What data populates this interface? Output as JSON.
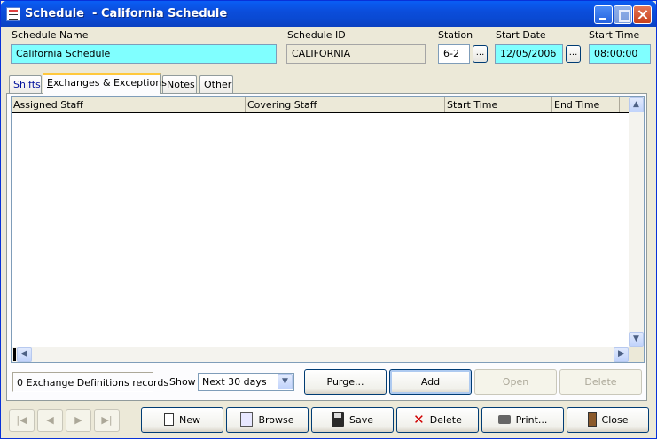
{
  "window": {
    "title": "Schedule  - California Schedule"
  },
  "header": {
    "schedule_name_label": "Schedule Name",
    "schedule_name_value": "California Schedule",
    "schedule_id_label": "Schedule ID",
    "schedule_id_value": "CALIFORNIA",
    "station_label": "Station",
    "station_value": "6-2",
    "start_date_label": "Start Date",
    "start_date_value": "12/05/2006",
    "start_time_label": "Start Time",
    "start_time_value": "08:00:00",
    "lookup_label": "..."
  },
  "tabs": [
    {
      "pre": "S",
      "ul": "h",
      "post": "ifts"
    },
    {
      "pre": "",
      "ul": "E",
      "post": "xchanges & Exceptions"
    },
    {
      "pre": "",
      "ul": "N",
      "post": "otes"
    },
    {
      "pre": "",
      "ul": "O",
      "post": "ther"
    }
  ],
  "grid": {
    "columns": [
      "Assigned Staff",
      "Covering Staff",
      "Start Time",
      "End Time"
    ]
  },
  "footer": {
    "record_count": "0 Exchange Definitions records",
    "show_label": "Show",
    "show_value": "Next 30 days",
    "purge_label": "Purge...",
    "add_label": "Add",
    "open_label": "Open",
    "delete_label": "Delete"
  },
  "toolbar": {
    "new_label": "New",
    "browse_label": "Browse",
    "save_label": "Save",
    "delete_label": "Delete",
    "print_label": "Print...",
    "close_label": "Close"
  },
  "icons": {
    "app": "schedule-app-icon",
    "first": "first-record-icon",
    "prev": "previous-record-icon",
    "next": "next-record-icon",
    "last": "last-record-icon"
  },
  "colors": {
    "title_bar": "#0a4ddb",
    "highlight_field": "#80ffff",
    "active_tab_accent": "#ffc83c"
  }
}
